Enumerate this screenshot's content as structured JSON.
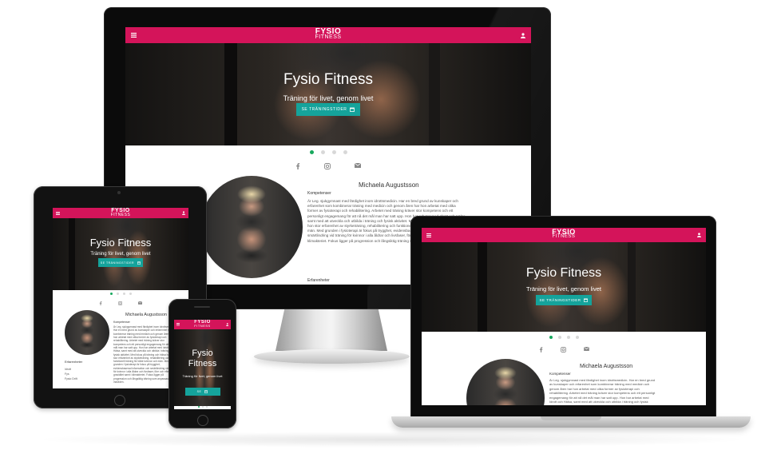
{
  "site": {
    "logo_line1": "FYSIO",
    "logo_line2": "FITNESS",
    "hero_title": "Fysio Fitness",
    "hero_subtitle": "Träning för livet, genom livet",
    "cta_label": "SE TRÄNINGSTIDER",
    "cta_label_phone": "SE",
    "trainer_name": "Michaela Augustsson",
    "trainer_role": "Kompetenser",
    "trainer_text": "Är Leg. sjukgymnast med färdighet inom idrottsmedicin. Har en bred grund av kunskaper och erfarenhet som kombinerar träning med medicin och genom åren har hon arbetat med olika former av fysioterapi och rehabilitering. Arbetet med träning kräver stor kompetens och ett personligt engagemang för att nå det mål man har satt upp. Hon har arbetat med Idrott och Hälsa, samt med att utveckla och utbilda i träning och fysisk aktivitet. Med fokus på träning och hälsa har hon stor erfarenhet av styrketräning, rehabilitering och funktionell träning för både kvinnor och män. Med grunden i fysioterapi är fokus på trygghet, evidensbaserad information och smärtlindring vid träning för kvinnor i alla åldrar och livsfaser, före och efter graviditet samt i klimakteriet. Fokus ligger på progression och långsiktig träning som anpassas efter individen.",
    "more_label": "Erfarenheter",
    "phone_menu_items": [
      "Idrott",
      "Fys",
      "Fysio Drift"
    ]
  },
  "colors": {
    "brand": "#d4145a",
    "accent": "#15a39b",
    "dot_active": "#17a85d"
  },
  "icons": {
    "menu": "hamburger-icon",
    "user": "user-icon",
    "facebook": "facebook-icon",
    "instagram": "instagram-icon",
    "email": "mail-icon",
    "calendar": "calendar-icon"
  }
}
